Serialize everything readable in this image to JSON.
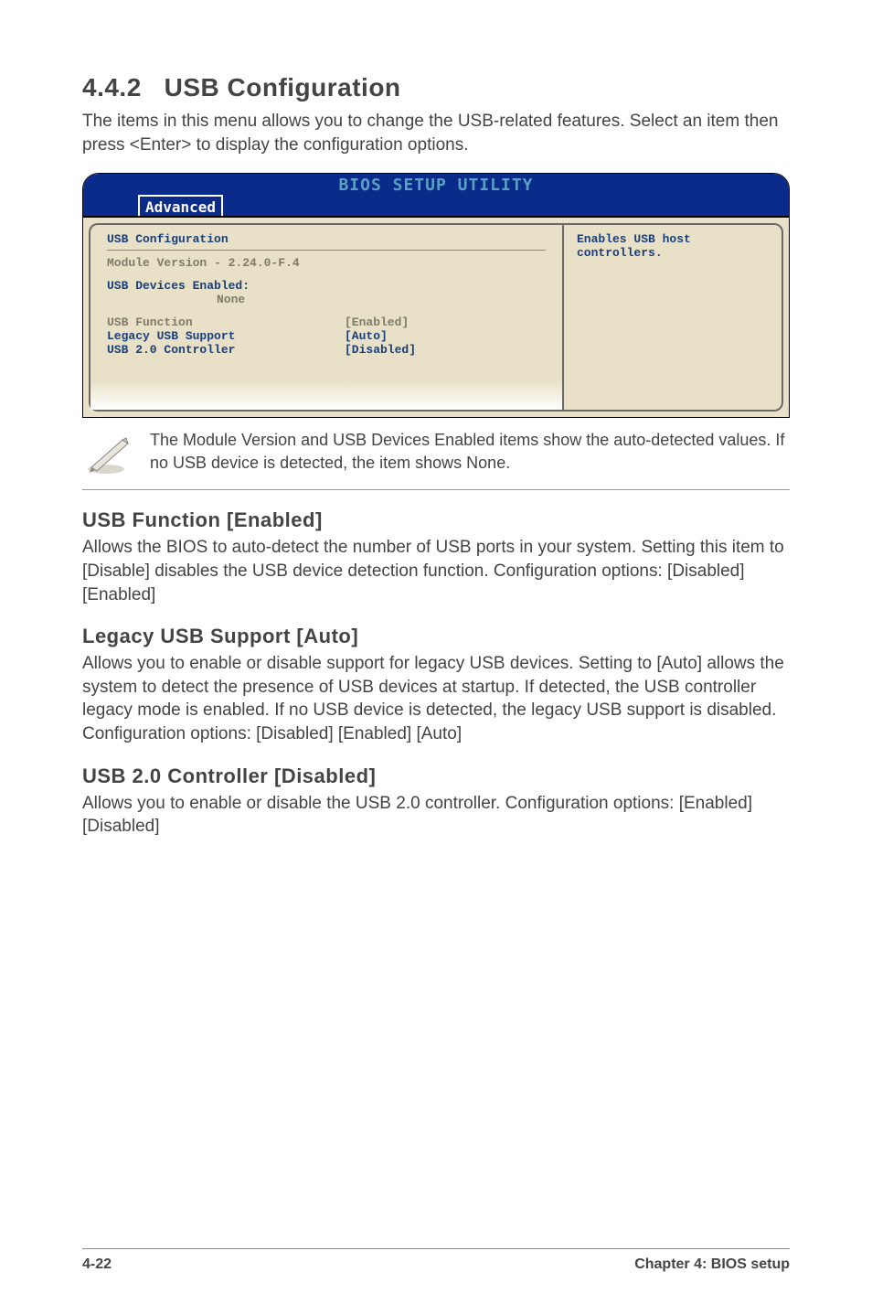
{
  "heading": {
    "number": "4.4.2",
    "title": "USB Configuration"
  },
  "intro": "The items in this menu allows you to change the USB-related features. Select an item then press <Enter> to display the configuration options.",
  "bios": {
    "title": "BIOS SETUP UTILITY",
    "tab": "Advanced",
    "left": {
      "section_title": "USB Configuration",
      "module_line": "Module Version - 2.24.0-F.4",
      "devices_label": "USB Devices Enabled:",
      "devices_value": "None",
      "rows": [
        {
          "label": "USB Function",
          "value": "[Enabled]"
        },
        {
          "label": "Legacy USB Support",
          "value": "[Auto]"
        },
        {
          "label": "USB 2.0 Controller",
          "value": "[Disabled]"
        }
      ]
    },
    "right": {
      "help": "Enables USB host controllers."
    }
  },
  "note_text": "The Module Version and USB Devices Enabled items show the auto-detected values. If no USB device is detected, the item shows None.",
  "sections": [
    {
      "title": "USB Function [Enabled]",
      "body": "Allows the BIOS to auto-detect the number of USB ports in your system. Setting this item to [Disable] disables the USB device detection function. Configuration options: [Disabled] [Enabled]"
    },
    {
      "title": "Legacy USB Support [Auto]",
      "body": "Allows you to enable or disable support for legacy USB devices. Setting to [Auto] allows the system to detect the presence of USB devices at startup. If detected, the USB controller legacy mode is enabled. If no USB device is detected, the legacy USB support is disabled. Configuration options: [Disabled] [Enabled] [Auto]"
    },
    {
      "title": "USB 2.0 Controller [Disabled]",
      "body": "Allows you to enable or disable the USB 2.0 controller. Configuration options: [Enabled] [Disabled]"
    }
  ],
  "footer": {
    "left": "4-22",
    "right": "Chapter 4: BIOS setup"
  }
}
